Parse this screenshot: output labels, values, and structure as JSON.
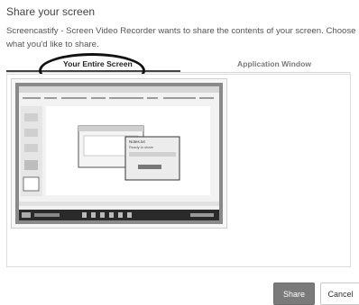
{
  "dialog": {
    "title": "Share your screen",
    "description": "Screencastify - Screen Video Recorder wants to share the contents of your screen. Choose what you'd like to share."
  },
  "tabs": [
    {
      "label": "Your Entire Screen",
      "selected": true
    },
    {
      "label": "Application Window",
      "selected": false
    }
  ],
  "preview": {
    "inner_popup_title": "Notes.txt",
    "inner_popup_subtitle": "Ready to share"
  },
  "buttons": {
    "share": "Share",
    "cancel": "Cancel"
  },
  "colors": {
    "share_bg": "#7a7a7a",
    "tab_underline": "#444444",
    "annotation_ring": "#111111"
  }
}
